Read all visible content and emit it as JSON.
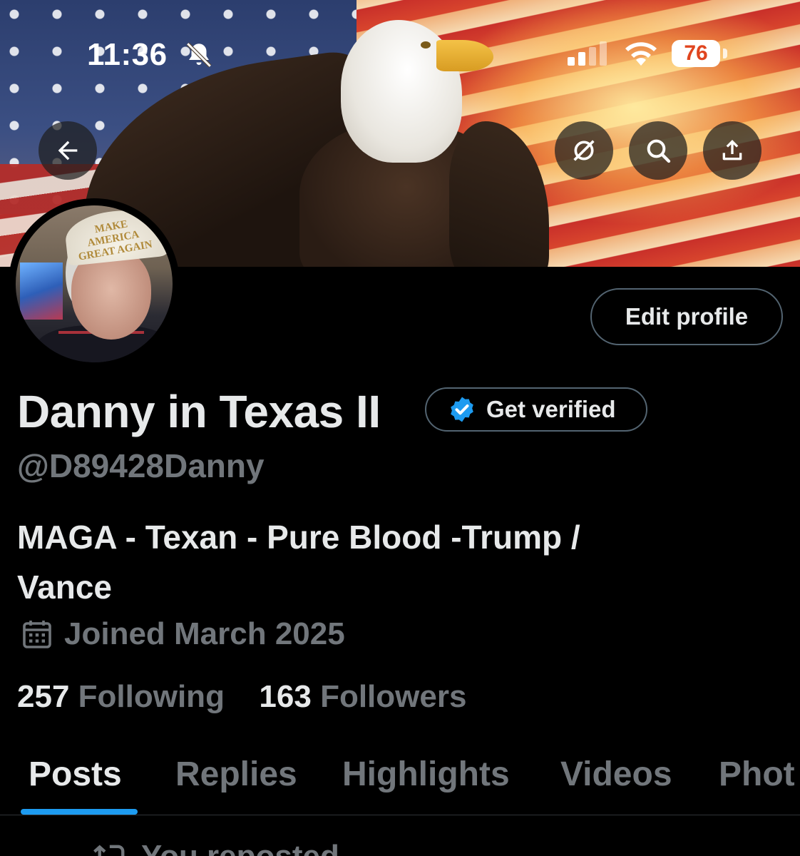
{
  "status_bar": {
    "time": "11:36",
    "battery": "76",
    "battery_color": "#e0451f"
  },
  "banner_actions": {
    "back_icon": "arrow-left-icon",
    "grok_icon": "grok-icon",
    "search_icon": "search-icon",
    "share_icon": "share-icon"
  },
  "avatar": {
    "hat_text": "MAKE AMERICA GREAT AGAIN"
  },
  "profile": {
    "edit_label": "Edit profile",
    "display_name": "Danny in Texas II",
    "get_verified_label": "Get verified",
    "handle": "@D89428Danny",
    "bio_line1": "MAGA - Texan - Pure Blood -Trump /",
    "bio_line2": "Vance",
    "joined": "Joined March 2025",
    "following_count": "257",
    "following_label": "Following",
    "followers_count": "163",
    "followers_label": "Followers"
  },
  "tabs": [
    {
      "label": "Posts",
      "active": true
    },
    {
      "label": "Replies",
      "active": false
    },
    {
      "label": "Highlights",
      "active": false
    },
    {
      "label": "Videos",
      "active": false
    },
    {
      "label": "Phot",
      "active": false
    }
  ],
  "feed": {
    "repost_label": "You reposted"
  },
  "colors": {
    "accent": "#1d9bf0",
    "muted_text": "#71767b",
    "primary_text": "#e7e9ea",
    "background": "#000000"
  }
}
